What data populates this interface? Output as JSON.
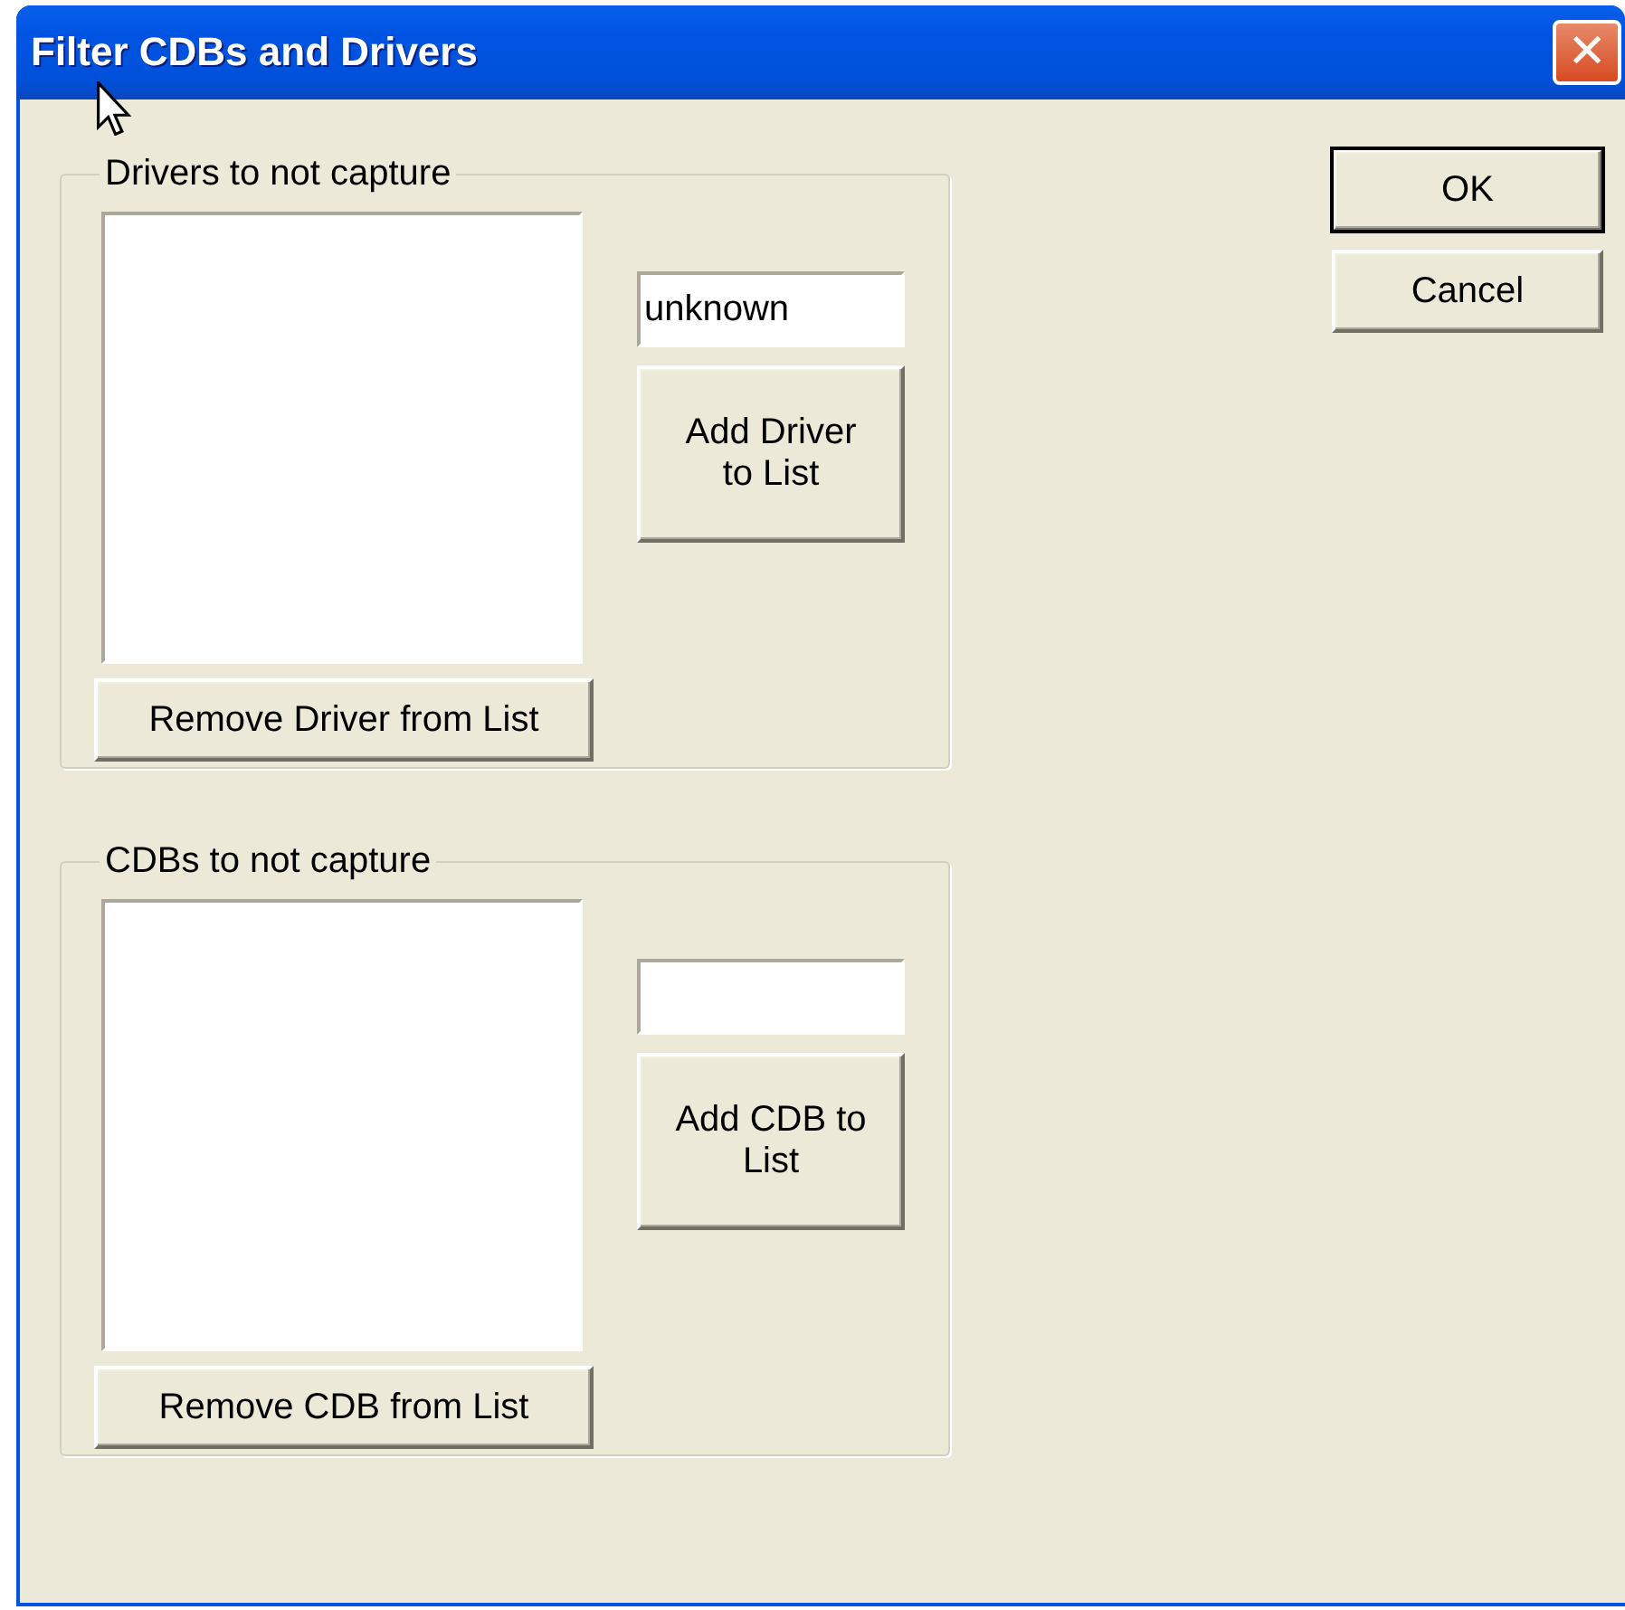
{
  "window": {
    "title": "Filter CDBs and Drivers",
    "close": "✕"
  },
  "groups": [
    {
      "label": "Drivers to not capture",
      "field": {
        "value": "unknown"
      },
      "add_button": "Add Driver to List",
      "remove_button": "Remove Driver from List"
    },
    {
      "label": "CDBs to not capture",
      "add_button": "Add CDB to List",
      "remove_button": "Remove CDB from List"
    }
  ],
  "buttons": [
    {
      "label": "OK",
      "default": true
    },
    {
      "label": "Cancel",
      "default": false
    }
  ]
}
